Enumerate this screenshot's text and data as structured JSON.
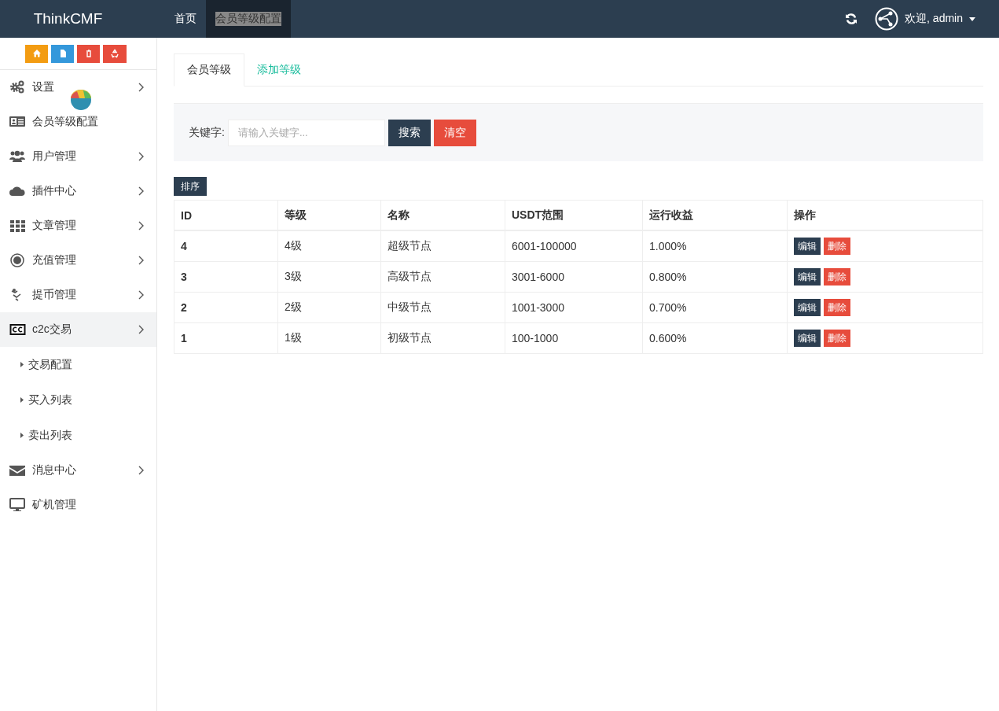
{
  "header": {
    "brand": "ThinkCMF",
    "nav": [
      {
        "label": "首页",
        "selected": false
      },
      {
        "label": "会员等级配置",
        "selected": true
      }
    ],
    "user": "欢迎, admin"
  },
  "sidebar": {
    "quick_buttons": [
      {
        "color": "#f39c12"
      },
      {
        "color": "#3498db"
      },
      {
        "color": "#e74c3c"
      },
      {
        "color": "#e74c3c"
      }
    ],
    "items": [
      {
        "label": "设置",
        "expandable": true,
        "expanded": false
      },
      {
        "label": "会员等级配置",
        "expandable": false,
        "expanded": false
      },
      {
        "label": "用户管理",
        "expandable": true,
        "expanded": false
      },
      {
        "label": "插件中心",
        "expandable": true,
        "expanded": false
      },
      {
        "label": "文章管理",
        "expandable": true,
        "expanded": false
      },
      {
        "label": "充值管理",
        "expandable": true,
        "expanded": false
      },
      {
        "label": "提币管理",
        "expandable": true,
        "expanded": false
      },
      {
        "label": "c2c交易",
        "expandable": true,
        "expanded": true,
        "children": [
          {
            "label": "交易配置"
          },
          {
            "label": "买入列表"
          },
          {
            "label": "卖出列表"
          }
        ]
      },
      {
        "label": "消息中心",
        "expandable": true,
        "expanded": false
      },
      {
        "label": "矿机管理",
        "expandable": false,
        "expanded": false
      }
    ]
  },
  "tabs": [
    {
      "label": "会员等级",
      "selected": true
    },
    {
      "label": "添加等级",
      "selected": false
    }
  ],
  "search": {
    "label": "关键字:",
    "placeholder": "请输入关键字...",
    "buttons": [
      {
        "label": "搜索",
        "kind": "primary"
      },
      {
        "label": "清空",
        "kind": "danger"
      }
    ]
  },
  "sort_button": "排序",
  "table": {
    "columns": [
      "ID",
      "等级",
      "名称",
      "USDT范围",
      "运行收益",
      "操作"
    ],
    "rows": [
      {
        "id": "4",
        "level": "4级",
        "name": "超级节点",
        "range": "6001-100000",
        "yield": "1.000%",
        "actions": [
          "编辑",
          "删除"
        ]
      },
      {
        "id": "3",
        "level": "3级",
        "name": "高级节点",
        "range": "3001-6000",
        "yield": "0.800%",
        "actions": [
          "编辑",
          "删除"
        ]
      },
      {
        "id": "2",
        "level": "2级",
        "name": "中级节点",
        "range": "1001-3000",
        "yield": "0.700%",
        "actions": [
          "编辑",
          "删除"
        ]
      },
      {
        "id": "1",
        "level": "1级",
        "name": "初级节点",
        "range": "100-1000",
        "yield": "0.600%",
        "actions": [
          "编辑",
          "删除"
        ]
      }
    ]
  }
}
